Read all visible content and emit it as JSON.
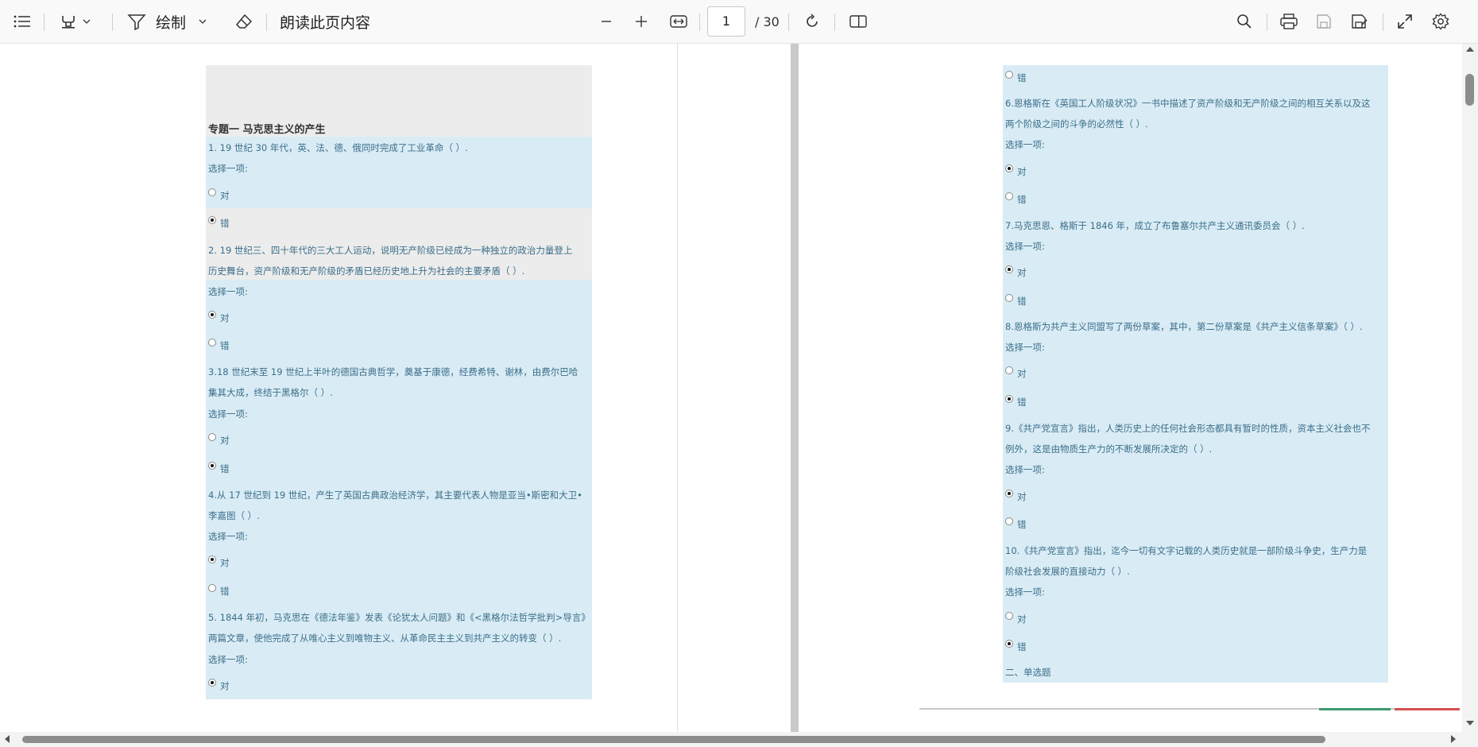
{
  "toolbar": {
    "draw_label": "绘制",
    "read_aloud_label": "朗读此页内容",
    "current_page": "1",
    "total_pages": "/ 30"
  },
  "left_page": {
    "heading": "专题一   马克思主义的产生",
    "lines": [
      "1. 19 世纪 30 年代，英、法、德、俄同时完成了工业革命（ ）.",
      "选择一项:",
      "2. 19 世纪三、四十年代的三大工人运动，说明无产阶级已经成为一种独立的政治力量登上",
      "历史舞台，资产阶级和无产阶级的矛盾已经历史地上升为社会的主要矛盾（ ）.",
      "选择一项:",
      "3.18 世纪末至 19 世纪上半叶的德国古典哲学，奠基于康德，经费希特、谢林，由费尔巴哈",
      "集其大成，终结于黑格尔（ ）.",
      "选择一项:",
      "4.从 17 世纪到 19 世纪，产生了英国古典政治经济学，其主要代表人物是亚当•斯密和大卫•",
      "李嘉图（ ）.",
      "选择一项:",
      "5. 1844 年初，马克思在《德法年鉴》发表《论犹太人问题》和《<黑格尔法哲学批判>导言》",
      "两篇文章，使他完成了从唯心主义到唯物主义、从革命民主主义到共产主义的转变（ ）.",
      "选择一项:"
    ],
    "options": [
      "对",
      "错",
      "对",
      "错",
      "对",
      "错",
      "对",
      "错",
      "对"
    ]
  },
  "right_page": {
    "lines": [
      "6.恩格斯在《英国工人阶级状况》一书中描述了资产阶级和无产阶级之间的相互关系以及这",
      "两个阶级之间的斗争的必然性（ ）.",
      "选择一项:",
      "7.马克思恩、格斯于 1846 年，成立了布鲁塞尔共产主义通讯委员会（ ）.",
      "选择一项:",
      "8.恩格斯为共产主义同盟写了两份草案，其中，第二份草案是《共产主义信条草案》（ ）.",
      "选择一项:",
      "9.《共产党宣言》指出，人类历史上的任何社会形态都具有暂时的性质，资本主义社会也不",
      "例外，这是由物质生产力的不断发展所决定的（ ）.",
      "选择一项:",
      "10.《共产党宣言》指出，迄今一切有文字记载的人类历史就是一部阶级斗争史，生产力是",
      "阶级社会发展的直接动力（ ）.",
      "选择一项:",
      "二、单选题"
    ],
    "options": [
      "错",
      "对",
      "错",
      "对",
      "错",
      "对",
      "错",
      "对",
      "错",
      "对",
      "错"
    ]
  }
}
